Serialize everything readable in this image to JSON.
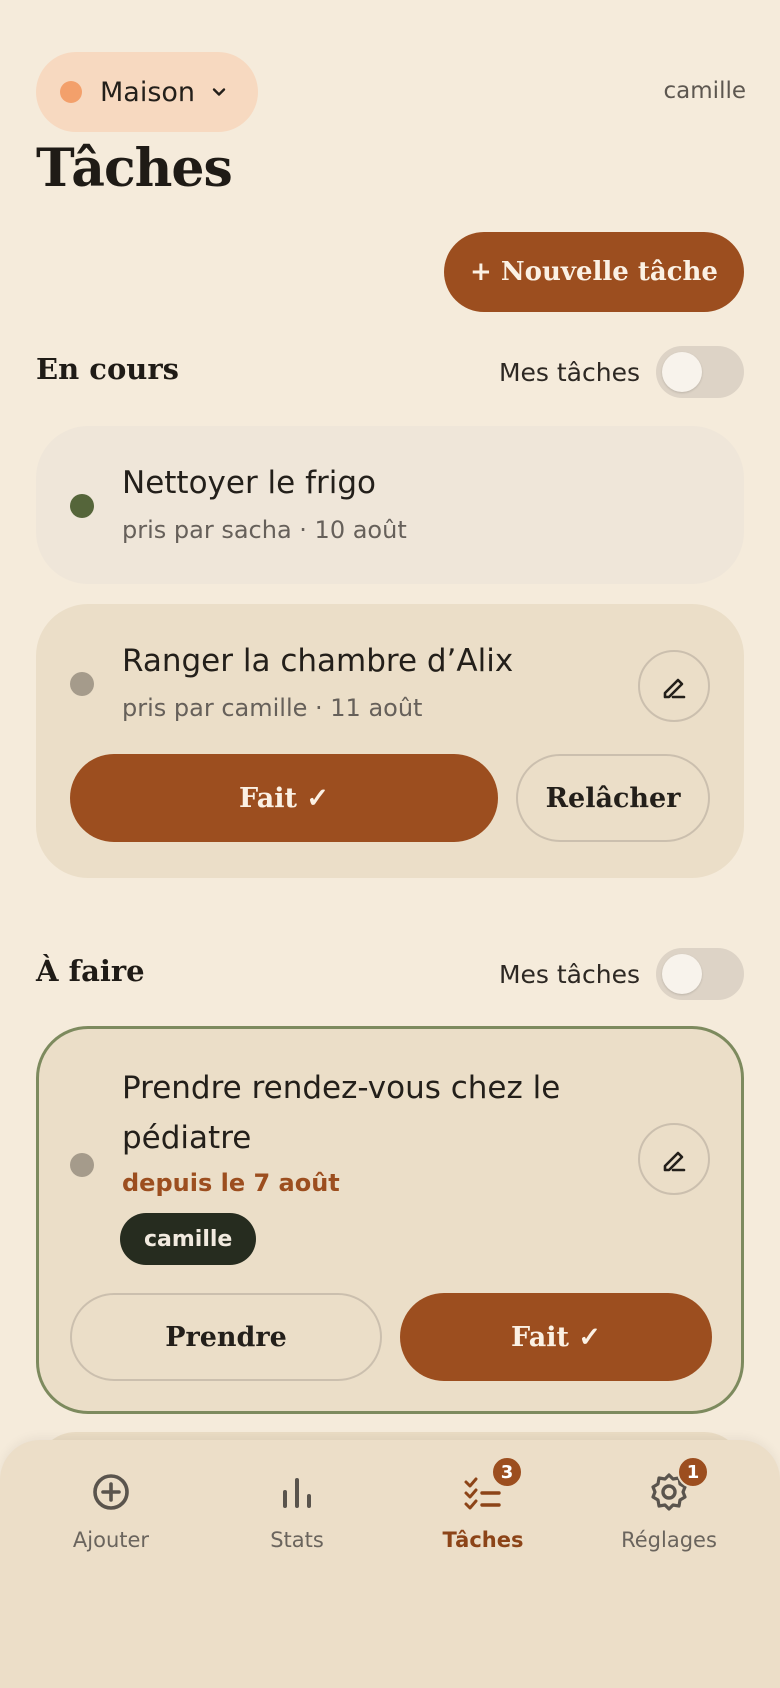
{
  "header": {
    "house": "Maison",
    "house_color": "#f3a06b",
    "user": "camille",
    "title": "Tâches",
    "new_task_label": "+ Nouvelle tâche"
  },
  "sections": {
    "in_progress": {
      "title": "En cours",
      "filter_label": "Mes tâches",
      "filter_on": false,
      "cards": [
        {
          "title": "Nettoyer le frigo",
          "meta": "pris par sacha · 10 août",
          "dot_color": "#55653a"
        },
        {
          "title": "Ranger la chambre d’Alix",
          "meta": "pris par camille · 11 août",
          "dot_color": "#a59b8b",
          "done_label": "Fait ✓",
          "release_label": "Relâcher"
        }
      ]
    },
    "todo": {
      "title": "À faire",
      "filter_label": "Mes tâches",
      "filter_on": false,
      "cards": [
        {
          "title_line1": "Prendre rendez-vous chez le",
          "title_line2": "pédiatre",
          "meta": "depuis le 7 août",
          "assignee": "camille",
          "dot_color": "#a59b8b",
          "take_label": "Prendre",
          "done_label": "Fait ✓",
          "border_color": "#7d8a5e"
        }
      ]
    }
  },
  "nav": {
    "items": [
      {
        "label": "Ajouter",
        "icon": "add-circle-icon"
      },
      {
        "label": "Stats",
        "icon": "bar-chart-icon"
      },
      {
        "label": "Tâches",
        "icon": "checklist-icon",
        "badge": "3",
        "active": true
      },
      {
        "label": "Réglages",
        "icon": "gear-icon",
        "badge": "1"
      }
    ]
  },
  "colors": {
    "accent": "#9c4e1f",
    "background": "#f5ebdb"
  }
}
